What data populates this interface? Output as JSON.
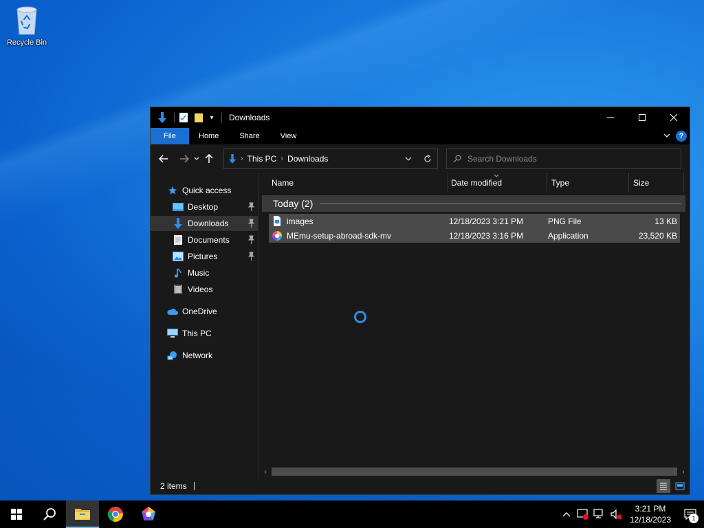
{
  "desktop": {
    "recycle_bin_label": "Recycle Bin"
  },
  "window": {
    "title": "Downloads",
    "controls": {
      "minimize": "—",
      "maximize": "☐",
      "close": "✕"
    }
  },
  "ribbon": {
    "tabs": [
      "File",
      "Home",
      "Share",
      "View"
    ],
    "help": "?"
  },
  "address": {
    "crumbs": [
      "This PC",
      "Downloads"
    ]
  },
  "search": {
    "placeholder": "Search Downloads"
  },
  "nav": {
    "quick_access": "Quick access",
    "items": [
      "Desktop",
      "Downloads",
      "Documents",
      "Pictures",
      "Music",
      "Videos"
    ],
    "onedrive": "OneDrive",
    "this_pc": "This PC",
    "network": "Network"
  },
  "columns": [
    "Name",
    "Date modified",
    "Type",
    "Size"
  ],
  "group": {
    "label": "Today (2)"
  },
  "files": [
    {
      "name": "images",
      "date": "12/18/2023 3:21 PM",
      "type": "PNG File",
      "size": "13 KB"
    },
    {
      "name": "MEmu-setup-abroad-sdk-mv",
      "date": "12/18/2023 3:16 PM",
      "type": "Application",
      "size": "23,520 KB"
    }
  ],
  "status": {
    "count": "2 items"
  },
  "taskbar": {
    "time": "3:21 PM",
    "date": "12/18/2023",
    "notifications": "1"
  },
  "colors": {
    "accent": "#1a6fd0",
    "window_bg": "#191919",
    "selection_bg": "#4a4a4a",
    "spinner": "#2a8ef0"
  }
}
